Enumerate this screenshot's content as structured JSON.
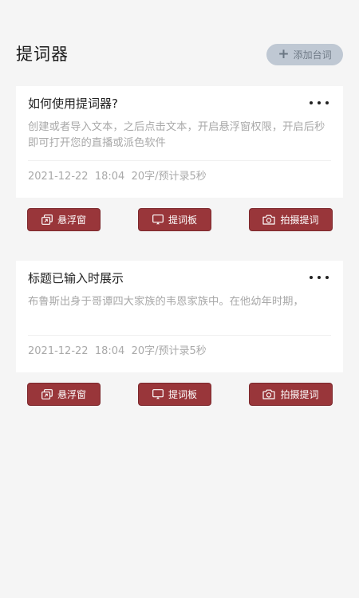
{
  "header": {
    "title": "提词器",
    "add_button_label": "添加台词",
    "add_icon": "plus-icon"
  },
  "cards": [
    {
      "title": "如何使用提词器?",
      "description": "创建或者导入文本，之后点击文本，开启悬浮窗权限，开启后秒即可打开您的直播或派色软件",
      "date": "2021-12-22",
      "time": "18:04",
      "stats": "20字/预计录5秒",
      "actions": {
        "float": "悬浮窗",
        "board": "提词板",
        "camera": "拍摄提词"
      }
    },
    {
      "title": "标题已输入时展示",
      "description": "布鲁斯出身于哥谭四大家族的韦恩家族中。在他幼年时期，",
      "date": "2021-12-22",
      "time": "18:04",
      "stats": "20字/预计录5秒",
      "actions": {
        "float": "悬浮窗",
        "board": "提词板",
        "camera": "拍摄提词"
      }
    }
  ],
  "colors": {
    "accent": "#99363a",
    "add_button_bg": "#bfc8d3",
    "background": "#f5f5f5"
  }
}
